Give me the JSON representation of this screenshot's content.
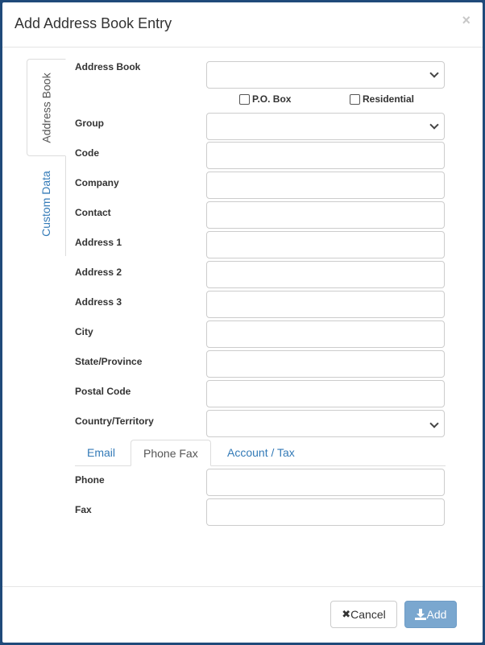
{
  "dialog": {
    "title": "Add Address Book Entry",
    "close_icon": "×"
  },
  "side_tabs": [
    {
      "label": "Address Book",
      "active": true
    },
    {
      "label": "Custom Data",
      "active": false
    }
  ],
  "fields": {
    "address_book": {
      "label": "Address Book",
      "type": "select",
      "value": ""
    },
    "po_box": {
      "label": "P.O. Box",
      "checked": false
    },
    "residential": {
      "label": "Residential",
      "checked": false
    },
    "group": {
      "label": "Group",
      "type": "select",
      "value": ""
    },
    "code": {
      "label": "Code",
      "value": ""
    },
    "company": {
      "label": "Company",
      "value": ""
    },
    "contact": {
      "label": "Contact",
      "value": ""
    },
    "address1": {
      "label": "Address 1",
      "value": ""
    },
    "address2": {
      "label": "Address 2",
      "value": ""
    },
    "address3": {
      "label": "Address 3",
      "value": ""
    },
    "city": {
      "label": "City",
      "value": ""
    },
    "state": {
      "label": "State/Province",
      "value": ""
    },
    "postal": {
      "label": "Postal Code",
      "value": ""
    },
    "country": {
      "label": "Country/Territory",
      "type": "select",
      "value": ""
    },
    "phone": {
      "label": "Phone",
      "value": ""
    },
    "fax": {
      "label": "Fax",
      "value": ""
    }
  },
  "contact_tabs": [
    {
      "label": "Email",
      "active": false
    },
    {
      "label": "Phone Fax",
      "active": true
    },
    {
      "label": "Account / Tax",
      "active": false
    }
  ],
  "footer": {
    "cancel_label": "Cancel",
    "cancel_icon": "✖",
    "add_label": "Add",
    "add_icon": "download-icon"
  }
}
